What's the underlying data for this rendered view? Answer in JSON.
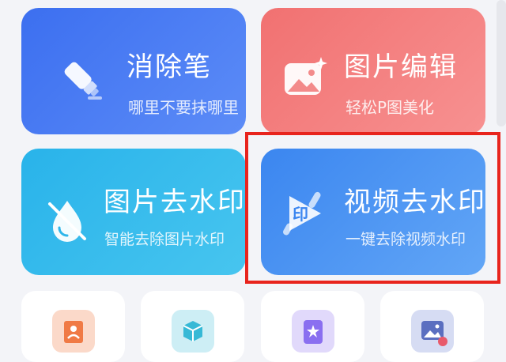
{
  "cards": {
    "eraser": {
      "title": "消除笔",
      "subtitle": "哪里不要抹哪里",
      "icon": "eraser-pen-icon"
    },
    "photo_edit": {
      "title": "图片编辑",
      "subtitle": "轻松P图美化",
      "icon": "image-sparkle-icon"
    },
    "image_watermark": {
      "title": "图片去水印",
      "subtitle": "智能去除图片水印",
      "icon": "water-drop-icon"
    },
    "video_watermark": {
      "title": "视频去水印",
      "subtitle": "一键去除视频水印",
      "icon": "video-stamp-icon"
    }
  },
  "tools": [
    {
      "icon": "portrait-frame-icon"
    },
    {
      "icon": "box-scan-icon"
    },
    {
      "icon": "star-doc-icon"
    },
    {
      "icon": "image-repair-icon"
    }
  ],
  "colors": {
    "eraser_card": "#3c6ff0",
    "photo_card": "#f17171",
    "image_wm_card": "#29b3ea",
    "video_wm_card": "#3b86f0",
    "highlight": "#e8241d"
  }
}
